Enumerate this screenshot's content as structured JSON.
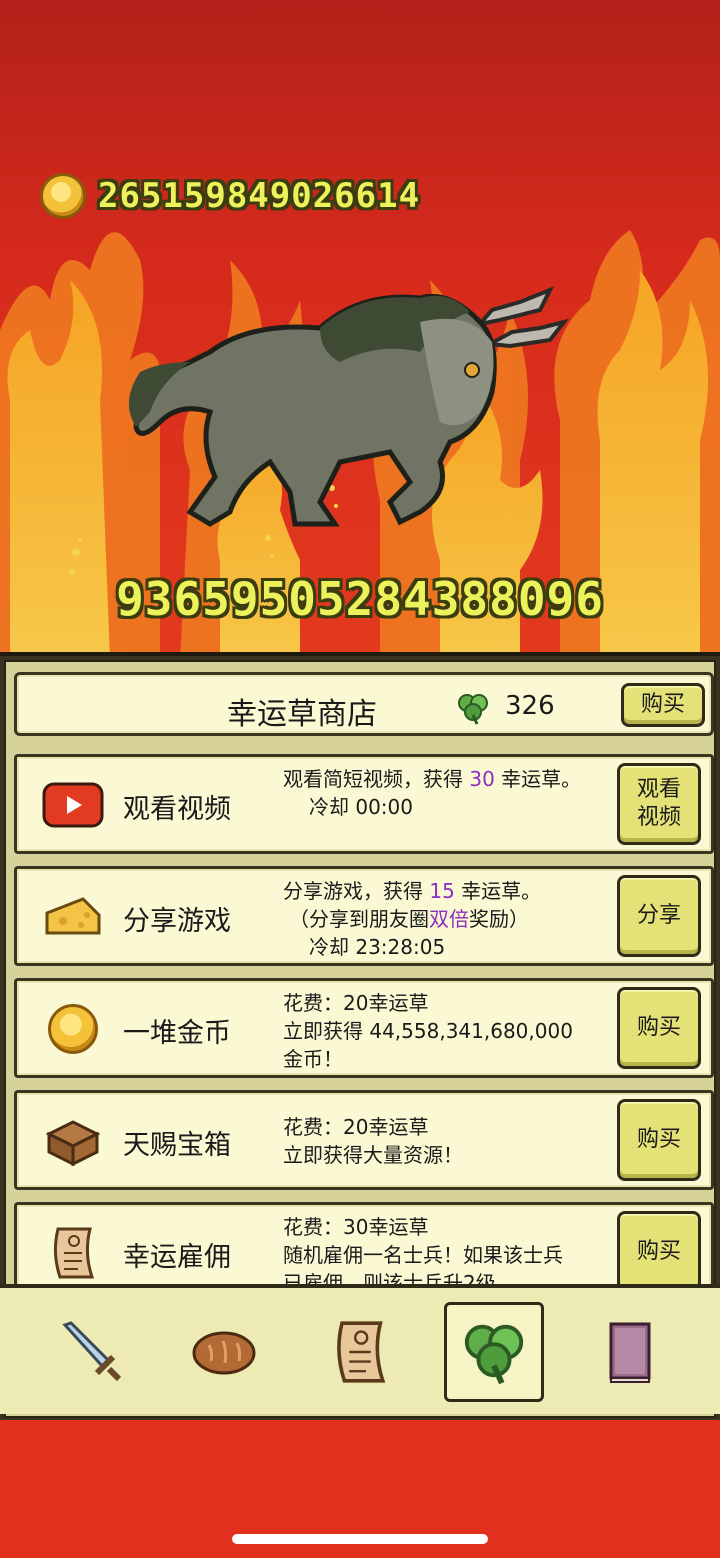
{
  "hud": {
    "gold_amount": "265159849026614",
    "enemy_hp": "93659505284388096"
  },
  "shop": {
    "title": "幸运草商店",
    "clover_count": "326",
    "buy_label": "购买"
  },
  "items": [
    {
      "icon": "video-play-icon",
      "title": "观看视频",
      "desc": [
        "观看简短视频，获得 ",
        "30",
        " 幸运草。"
      ],
      "line2": "冷却 00:00",
      "button": "观看视频",
      "button_lines": [
        "观看",
        "视频"
      ]
    },
    {
      "icon": "cheese-icon",
      "title": "分享游戏",
      "desc": [
        "分享游戏，获得 ",
        "15",
        " 幸运草。"
      ],
      "line2a": "（分享到朋友圈",
      "line2hl": "双倍",
      "line2b": "奖励）",
      "line3": "冷却 23:28:05",
      "button": "分享"
    },
    {
      "icon": "gold-coin-icon",
      "title": "一堆金币",
      "line1": "花费：20幸运草",
      "line2": "立即获得 44,558,341,680,000",
      "line3": "金币！",
      "button": "购买"
    },
    {
      "icon": "treasure-chest-icon",
      "title": "天赐宝箱",
      "line1": "花费：20幸运草",
      "line2": "立即获得大量资源！",
      "button": "购买"
    },
    {
      "icon": "scroll-icon",
      "title": "幸运雇佣",
      "line1": "花费：30幸运草",
      "line2": "随机雇佣一名士兵！如果该士兵",
      "line3": "已雇佣，则该士兵升2级。",
      "button": "购买"
    }
  ],
  "tabs": [
    {
      "name": "tab-battle",
      "icon": "sword-icon",
      "active": false
    },
    {
      "name": "tab-food",
      "icon": "bread-icon",
      "active": false
    },
    {
      "name": "tab-hire",
      "icon": "scroll-icon",
      "active": false
    },
    {
      "name": "tab-clover-shop",
      "icon": "clover-icon",
      "active": true
    },
    {
      "name": "tab-book",
      "icon": "book-icon",
      "active": false
    }
  ],
  "colors": {
    "background": "#e0301e",
    "gold_text": "#eef25a",
    "button": "#e4e276",
    "highlight": "#8a2fc0"
  }
}
